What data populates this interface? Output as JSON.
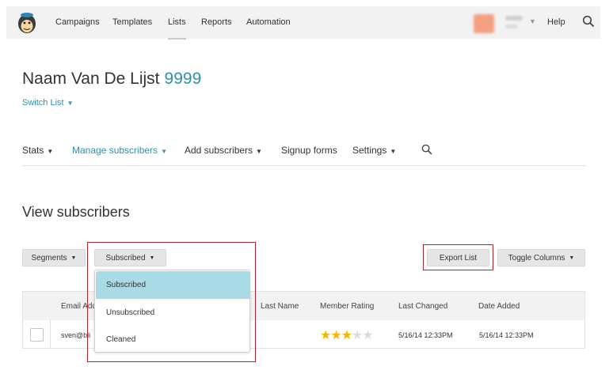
{
  "topnav": {
    "items": [
      "Campaigns",
      "Templates",
      "Lists",
      "Reports",
      "Automation"
    ],
    "active": "Lists",
    "help": "Help",
    "logo_icon": "chimp-logo-icon",
    "search_icon": "search-icon"
  },
  "list": {
    "title": "Naam Van De Lijst",
    "count": "9999",
    "switch_label": "Switch List"
  },
  "subnav": {
    "stats": "Stats",
    "manage": "Manage subscribers",
    "add": "Add subscribers",
    "signup": "Signup forms",
    "settings": "Settings"
  },
  "section": {
    "title": "View subscribers"
  },
  "toolbar": {
    "segments": "Segments",
    "status_selected": "Subscribed",
    "export": "Export List",
    "toggle_columns": "Toggle Columns"
  },
  "status_menu": {
    "options": [
      "Subscribed",
      "Unsubscribed",
      "Cleaned"
    ],
    "selected": "Subscribed"
  },
  "table": {
    "columns": [
      "Email Add",
      "Last Name",
      "Member Rating",
      "Last Changed",
      "Date Added"
    ],
    "rows": [
      {
        "email": "sven@bli",
        "rating": 3,
        "rating_max": 5,
        "last_changed": "5/16/14 12:33PM",
        "date_added": "5/16/14 12:33PM"
      }
    ]
  },
  "colors": {
    "accent": "#2f8fad",
    "highlight": "#b3262b",
    "selected_bg": "#a9dbe6",
    "star": "#f5b800"
  }
}
